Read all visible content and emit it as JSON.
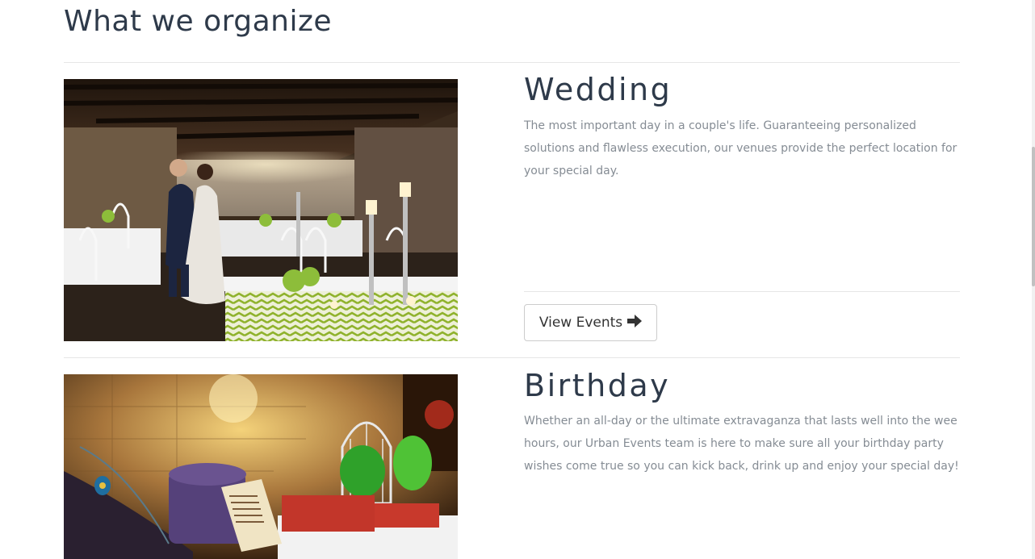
{
  "section": {
    "title": "What we organize"
  },
  "events": [
    {
      "title": "Wedding",
      "description": "The most important day in a couple's life. Guaranteeing personalized solutions and flawless execution, our venues provide the perfect location for your special day.",
      "button_label": "View Events",
      "button_icon": "arrow-right-icon"
    },
    {
      "title": "Birthday",
      "description": "Whether an all-day or the ultimate extravaganza that lasts well into the wee hours, our Urban Events team is here to make sure all your birthday party wishes come true so you can kick back, drink up and enjoy your special day!"
    }
  ],
  "colors": {
    "heading": "#2e3a4a",
    "body_text": "#858c94",
    "divider": "#e6e6e6",
    "button_border": "#cccccc"
  }
}
